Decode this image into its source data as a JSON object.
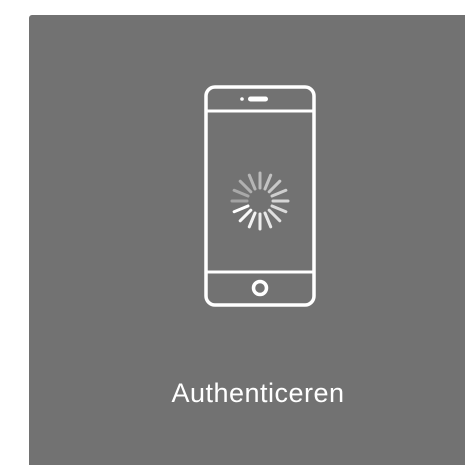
{
  "auth_card": {
    "label": "Authenticeren",
    "icon": "phone-loading-icon",
    "background_color": "#727272",
    "foreground_color": "#ffffff"
  }
}
